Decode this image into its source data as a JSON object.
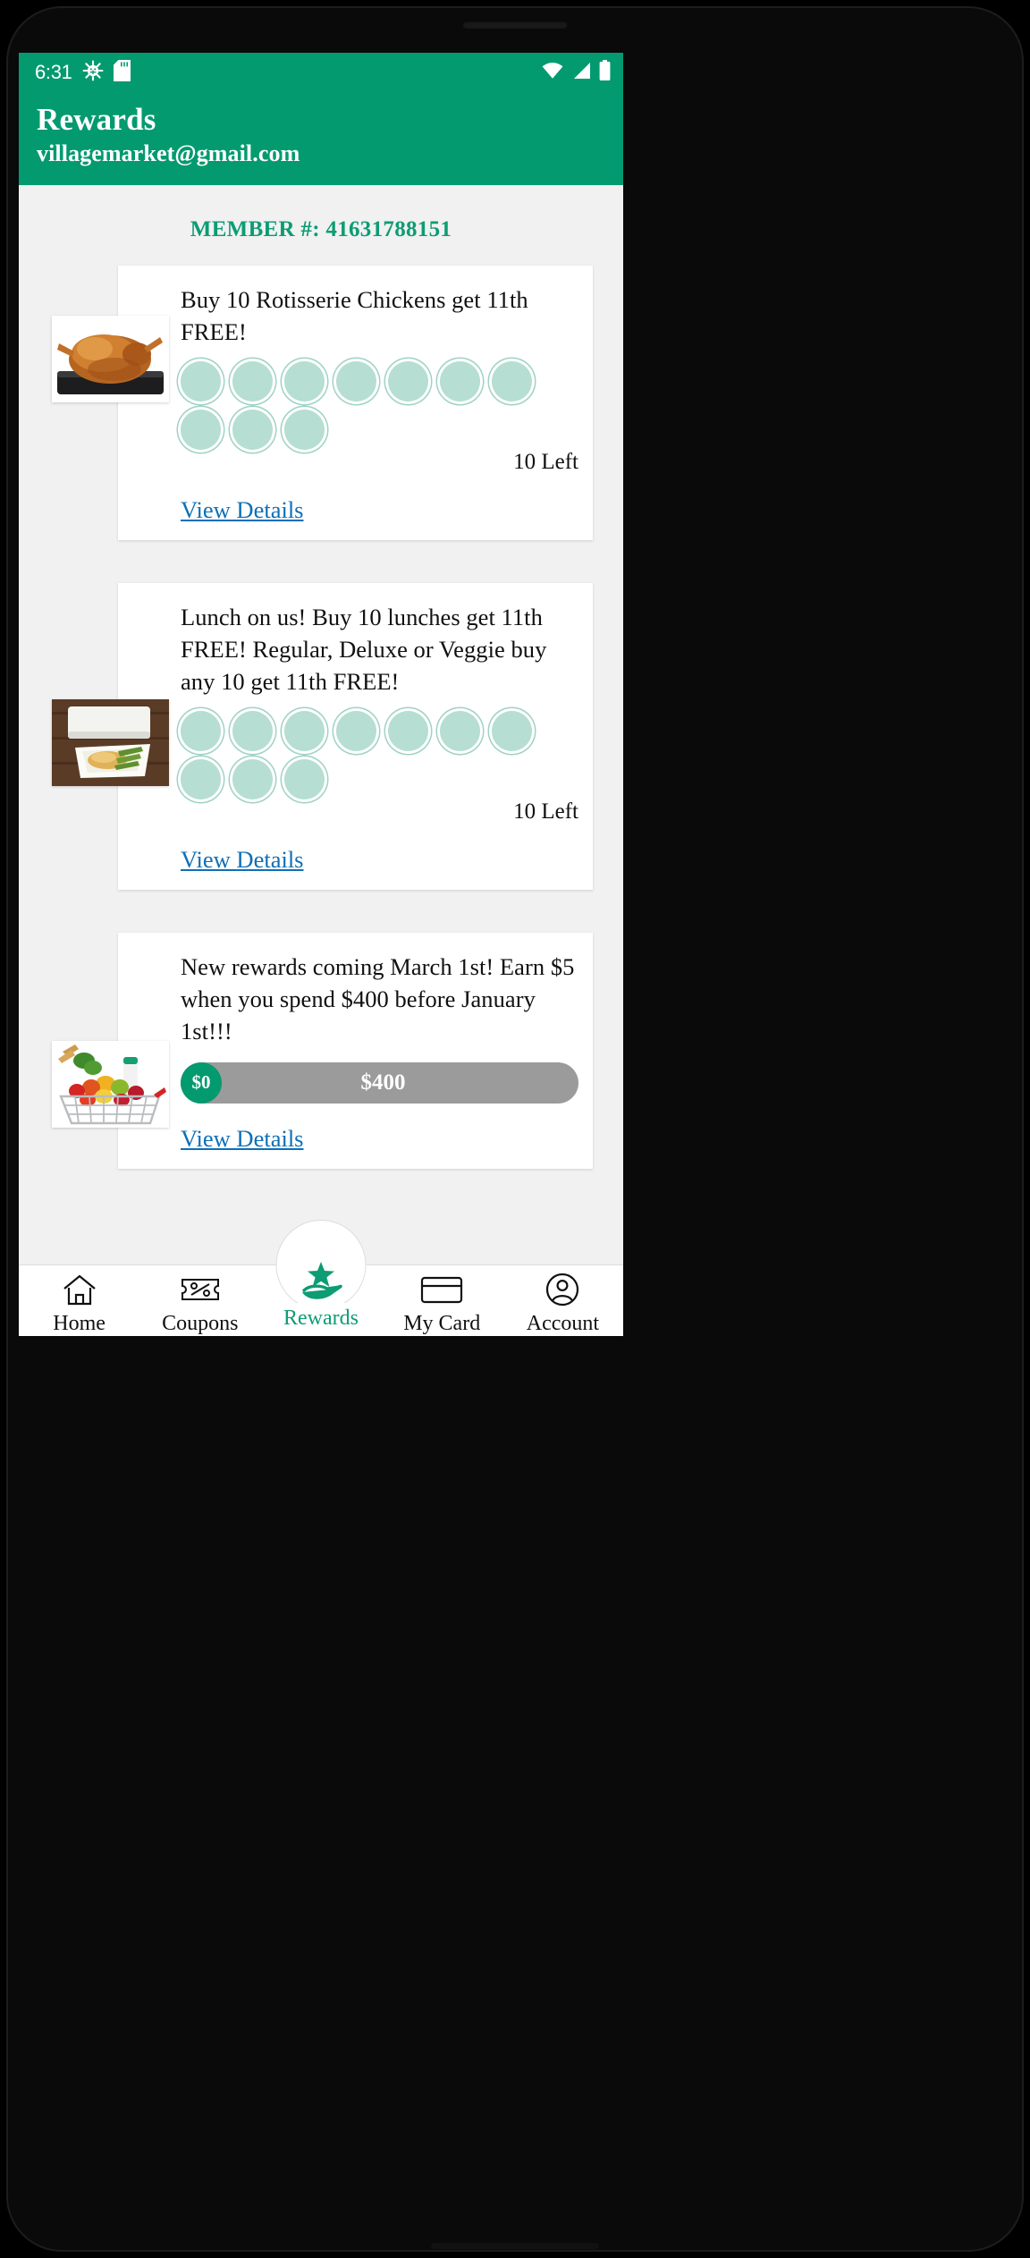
{
  "status_bar": {
    "time": "6:31",
    "left_icons": [
      "android-bug-icon",
      "sd-card-icon"
    ],
    "right_icons": [
      "wifi-icon",
      "cell-signal-icon",
      "battery-icon"
    ]
  },
  "header": {
    "title": "Rewards",
    "email": "villagemarket@gmail.com",
    "background_color": "#049a70"
  },
  "member": {
    "label": "MEMBER #:",
    "number": "41631788151",
    "full_text": "MEMBER #: 41631788151",
    "color": "#0d9c74"
  },
  "cards": [
    {
      "title": "Buy 10 Rotisserie Chickens get 11th FREE!",
      "image": "rotisserie-chicken-thumb",
      "punch_total": 10,
      "punch_filled": 0,
      "remaining_label": "10 Left",
      "link_label": "View Details"
    },
    {
      "title": "Lunch on us! Buy 10 lunches get 11th FREE! Regular, Deluxe or Veggie buy any 10 get 11th FREE!",
      "image": "lunch-box-thumb",
      "punch_total": 10,
      "punch_filled": 0,
      "remaining_label": "10 Left",
      "link_label": "View Details"
    },
    {
      "title": "New rewards coming March 1st! Earn $5 when you spend $400 before January 1st!!!",
      "image": "grocery-basket-thumb",
      "progress": {
        "current": "$0",
        "goal": "$400",
        "percent": 0
      },
      "link_label": "View Details"
    }
  ],
  "bottom_nav": {
    "active": "Rewards",
    "items": [
      {
        "label": "Home",
        "icon": "home-icon"
      },
      {
        "label": "Coupons",
        "icon": "coupon-percent-icon"
      },
      {
        "label": "Rewards",
        "icon": "hand-star-icon"
      },
      {
        "label": "My Card",
        "icon": "credit-card-icon"
      },
      {
        "label": "Account",
        "icon": "person-circle-icon"
      }
    ],
    "active_color": "#0d9c74"
  },
  "theme": {
    "green": "#049a70",
    "accent_green": "#0d9c74",
    "punch_fill": "#b6ded2",
    "punch_ring": "#9fd3c4",
    "link_blue": "#0d6fb8",
    "progress_track": "#9b9b9b"
  }
}
